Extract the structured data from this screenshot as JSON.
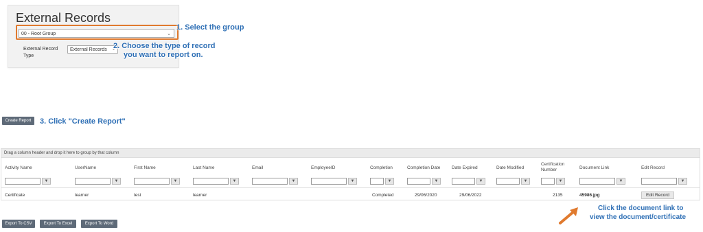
{
  "panel": {
    "title": "External Records",
    "group_select_value": "00 - Root Group",
    "record_type_label": "External Record Type",
    "record_type_value": "External Records"
  },
  "callouts": {
    "step1": "1. Select the group",
    "step2_line1": "2. Choose the type of record",
    "step2_line2": "you want to report on.",
    "step3": "3. Click \"Create Report\"",
    "note_line1": "Click the document link to",
    "note_line2": "view the document/certificate"
  },
  "buttons": {
    "create_report": "Create Report",
    "export_csv": "Export To CSV",
    "export_excel": "Export To Excel",
    "export_word": "Export To Word"
  },
  "grid": {
    "group_hint": "Drag a column header and drop it here to group by that column",
    "columns": [
      "Activity Name",
      "UserName",
      "First Name",
      "Last Name",
      "Email",
      "EmployeeID",
      "Completion",
      "Completion Date",
      "Date Expired",
      "Date Modified",
      "Certification Number",
      "Document Link",
      "Edit Record"
    ],
    "row": {
      "activity": "Certificate",
      "username": "learner",
      "first_name": "test",
      "last_name": "learner",
      "email": "",
      "employee_id": "",
      "completion": "Completed",
      "completion_date": "29/06/2020",
      "date_expired": "29/06/2022",
      "date_modified": "",
      "cert_number": "2135",
      "document_link": "45986.jpg",
      "edit_label": "Edit Record"
    }
  },
  "icons": {
    "filter": "filter-icon",
    "dropdown": "chevron-down-icon",
    "arrow": "arrow-icon"
  },
  "colors": {
    "highlight": "#e07a2e",
    "callout": "#2e6fb5",
    "button": "#5e6a78"
  }
}
